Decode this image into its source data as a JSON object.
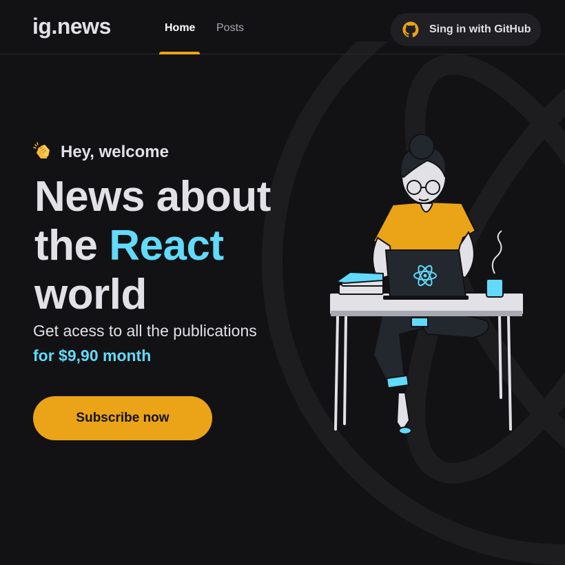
{
  "header": {
    "logo": "ig.news",
    "nav": [
      {
        "label": "Home",
        "active": true
      },
      {
        "label": "Posts",
        "active": false
      }
    ],
    "signin_label": "Sing in with GitHub",
    "signin_icon": "github-icon"
  },
  "hero": {
    "welcome_icon": "clapping-hands-icon",
    "welcome": "Hey, welcome",
    "headline_line1": "News about",
    "headline_line2_prefix": "the ",
    "headline_line2_accent": "React",
    "headline_line3": "world",
    "subtext": "Get acess to all the publications",
    "price": "for $9,90 month",
    "cta_label": "Subscribe now"
  },
  "colors": {
    "background": "#121214",
    "accent_yellow": "#eba417",
    "accent_cyan": "#61dafb",
    "text": "#e1e1e6",
    "muted": "#a8a8b3"
  }
}
